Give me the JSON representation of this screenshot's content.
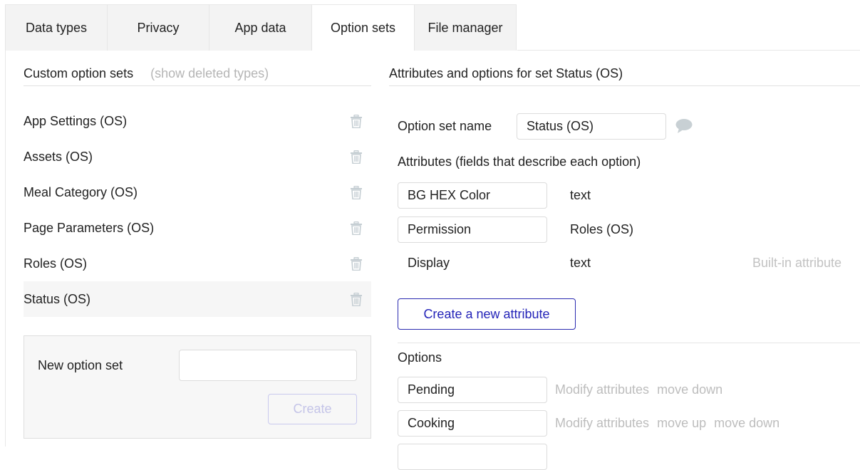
{
  "tabs": [
    {
      "label": "Data types",
      "active": false
    },
    {
      "label": "Privacy",
      "active": false
    },
    {
      "label": "App data",
      "active": false
    },
    {
      "label": "Option sets",
      "active": true
    },
    {
      "label": "File manager",
      "active": false
    }
  ],
  "left_panel": {
    "title": "Custom option sets",
    "show_deleted_link": "(show deleted types)",
    "option_sets": [
      {
        "name": "App Settings (OS)",
        "selected": false
      },
      {
        "name": "Assets (OS)",
        "selected": false
      },
      {
        "name": "Meal Category (OS)",
        "selected": false
      },
      {
        "name": "Page Parameters (OS)",
        "selected": false
      },
      {
        "name": "Roles (OS)",
        "selected": false
      },
      {
        "name": "Status (OS)",
        "selected": true
      }
    ],
    "new_set": {
      "label": "New option set",
      "value": "",
      "placeholder": "",
      "create_button": "Create"
    }
  },
  "right_panel": {
    "title": "Attributes and options for set Status (OS)",
    "name_label": "Option set name",
    "name_value": "Status (OS)",
    "attributes_label": "Attributes (fields that describe each option)",
    "attributes": [
      {
        "name": "BG HEX Color",
        "type": "text",
        "note": ""
      },
      {
        "name": "Permission",
        "type": "Roles (OS)",
        "note": ""
      },
      {
        "name": "Display",
        "type": "text",
        "note": "Built-in attribute"
      }
    ],
    "new_attribute_button": "Create a new attribute",
    "options_label": "Options",
    "options": [
      {
        "value": "Pending",
        "actions": [
          "Modify attributes",
          "move down"
        ]
      },
      {
        "value": "Cooking",
        "actions": [
          "Modify attributes",
          "move up",
          "move down"
        ]
      }
    ]
  },
  "colors": {
    "accent": "#2323b8",
    "muted_text": "#bdbdbd",
    "tab_bg": "#f3f3f3",
    "selected_row_bg": "#f6f6f6"
  }
}
